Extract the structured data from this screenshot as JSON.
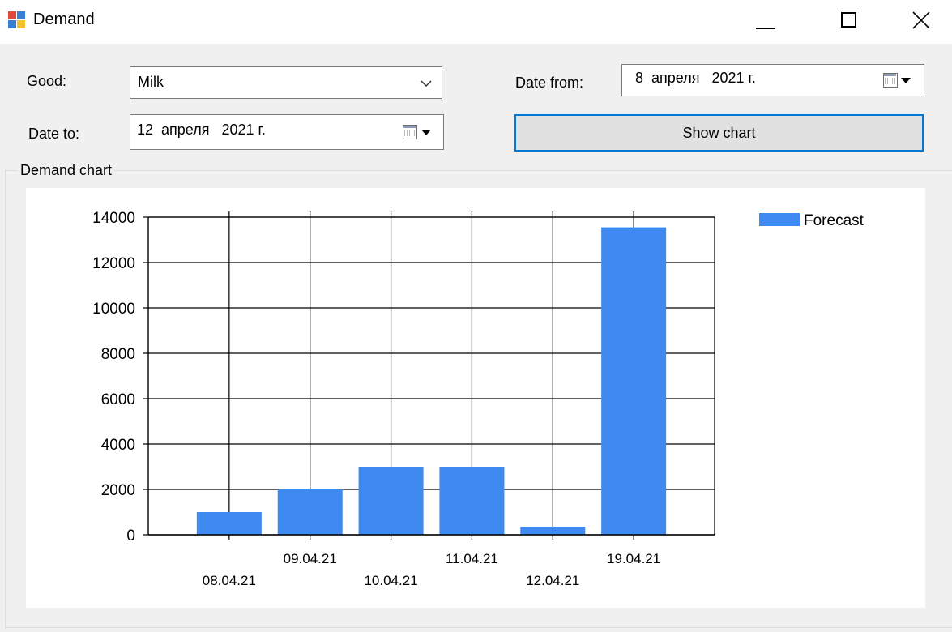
{
  "window": {
    "title": "Demand"
  },
  "form": {
    "good_label": "Good:",
    "good_value": "Milk",
    "date_from_label": "Date from:",
    "date_from_value": "8  апреля   2021 г.",
    "date_to_label": "Date to:",
    "date_to_value": "12  апреля   2021 г.",
    "show_button": "Show chart"
  },
  "group": {
    "title": "Demand chart"
  },
  "colors": {
    "bar": "#3f8af0",
    "button_border": "#0078d7"
  },
  "chart_data": {
    "type": "bar",
    "categories": [
      "08.04.21",
      "09.04.21",
      "10.04.21",
      "11.04.21",
      "12.04.21",
      "19.04.21"
    ],
    "series": [
      {
        "name": "Forecast",
        "values": [
          1000,
          2000,
          3000,
          3000,
          350,
          13550
        ]
      }
    ],
    "ylim": [
      0,
      14000
    ],
    "yticks": [
      0,
      2000,
      4000,
      6000,
      8000,
      10000,
      12000,
      14000
    ],
    "grid": true,
    "legend_position": "top-right"
  }
}
